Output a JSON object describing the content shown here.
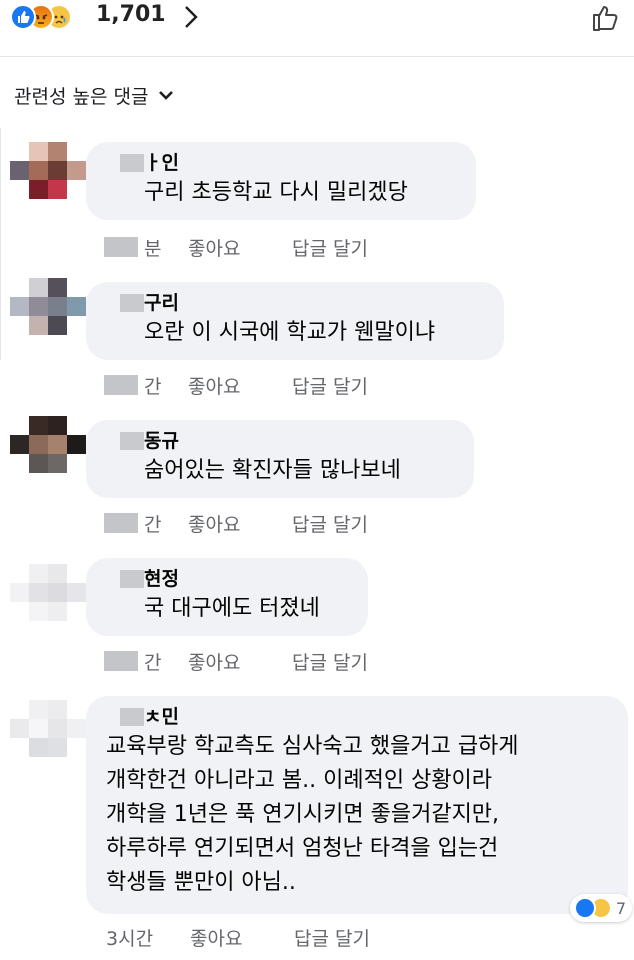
{
  "reactions_bar": {
    "count": "1,701",
    "icons": [
      "like-icon",
      "angry-icon",
      "sad-icon"
    ]
  },
  "sort": {
    "label": "관련성 높은 댓글"
  },
  "comments": [
    {
      "name": "ㅏ인",
      "text": "구리 초등학교 다시 밀리겠당",
      "time": "분",
      "like": "좋아요",
      "reply": "답글 달기"
    },
    {
      "name": "구리",
      "text": "오란 이 시국에 학교가 웬말이냐",
      "time": "간",
      "like": "좋아요",
      "reply": "답글 달기"
    },
    {
      "name": "동규",
      "text": "숨어있는 확진자들 많나보네",
      "time": "간",
      "like": "좋아요",
      "reply": "답글 달기"
    },
    {
      "name": "현정",
      "text": "국 대구에도 터졌네",
      "time": "간",
      "like": "좋아요",
      "reply": "답글 달기"
    },
    {
      "name": "ㅊ민",
      "lines": [
        "교육부랑 학교측도 심사숙고 했을거고 급하게",
        "개학한건 아니라고 봄.. 이례적인 상황이라",
        "개학을 1년은 푹 연기시키면 좋을거같지만,",
        "하루하루 연기되면서 엄청난 타격을 입는건",
        "학생들 뿐만이 아님.."
      ],
      "time": "3시간",
      "like": "좋아요",
      "reply": "답글 달기",
      "reaction_count": "7",
      "reaction_icons": [
        "like-icon",
        "sad-icon"
      ]
    }
  ],
  "colors": {
    "bubble": "#f0f2f5",
    "meta_text": "#65676b",
    "like_blue": "#1877f2"
  }
}
